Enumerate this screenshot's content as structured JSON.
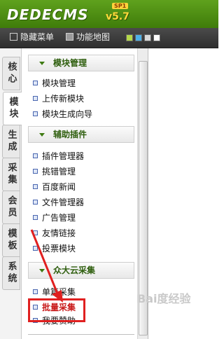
{
  "header": {
    "logo": "DEDECMS",
    "version": "v5.7",
    "badge": "SP1"
  },
  "toolbar": {
    "hide_menu": "隐藏菜单",
    "function_map": "功能地图",
    "swatches": [
      "#b5d94a",
      "#4db0e8",
      "#d9d9d9",
      "#ffffff"
    ]
  },
  "left_tabs": [
    {
      "label": "核心",
      "active": false
    },
    {
      "label": "模块",
      "active": true
    },
    {
      "label": "生成",
      "active": false
    },
    {
      "label": "采集",
      "active": false
    },
    {
      "label": "会员",
      "active": false
    },
    {
      "label": "模板",
      "active": false
    },
    {
      "label": "系统",
      "active": false
    }
  ],
  "menu": {
    "groups": [
      {
        "title": "模块管理",
        "items": [
          "模块管理",
          "上传新模块",
          "模块生成向导"
        ]
      },
      {
        "title": "辅助插件",
        "items": [
          "插件管理器",
          "挑错管理",
          "百度新闻",
          "文件管理器",
          "广告管理",
          "友情链接",
          "投票模块"
        ]
      },
      {
        "title": "众大云采集",
        "items": [
          "单篇采集",
          "批量采集",
          "我要赞助"
        ]
      }
    ]
  },
  "annotation": {
    "highlight_color": "#e02020",
    "highlighted_item": "批量采集"
  },
  "watermark": "Bai度经验"
}
